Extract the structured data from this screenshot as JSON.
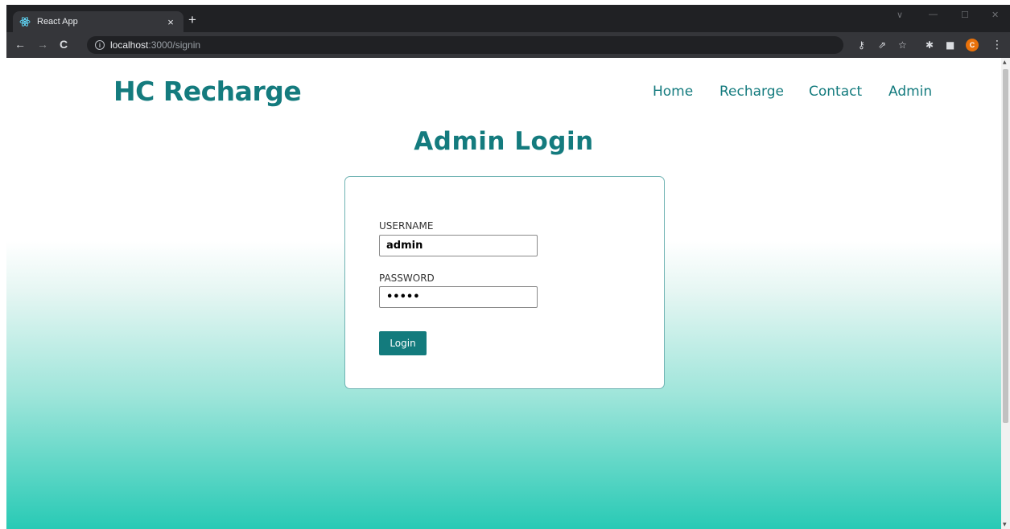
{
  "browser": {
    "tab_title": "React App",
    "tab_close": "×",
    "new_tab": "+",
    "url_host": "localhost",
    "url_rest": ":3000/signin",
    "nav": {
      "back": "←",
      "forward": "→",
      "reload": "C"
    },
    "window": {
      "minimize_caret": "∨",
      "minimize": "—",
      "maximize": "☐",
      "close": "✕"
    },
    "toolbar_icons": {
      "key": "⚷",
      "share": "⇗",
      "star": "☆",
      "extensions": "✱",
      "sidepanel": "■",
      "menu": "⋮"
    },
    "profile_initial": "C"
  },
  "site": {
    "brand": "HC Recharge",
    "nav_links": [
      "Home",
      "Recharge",
      "Contact",
      "Admin"
    ]
  },
  "page": {
    "title": "Admin Login"
  },
  "form": {
    "username_label": "USERNAME",
    "username_value": "admin",
    "password_label": "PASSWORD",
    "password_value": "•••••",
    "submit_label": "Login"
  },
  "colors": {
    "brand": "#147b7e",
    "button": "#137b7d",
    "gradient_bottom": "#28cab5"
  },
  "icons": {
    "favicon": "react-icon",
    "info": "info-icon"
  }
}
